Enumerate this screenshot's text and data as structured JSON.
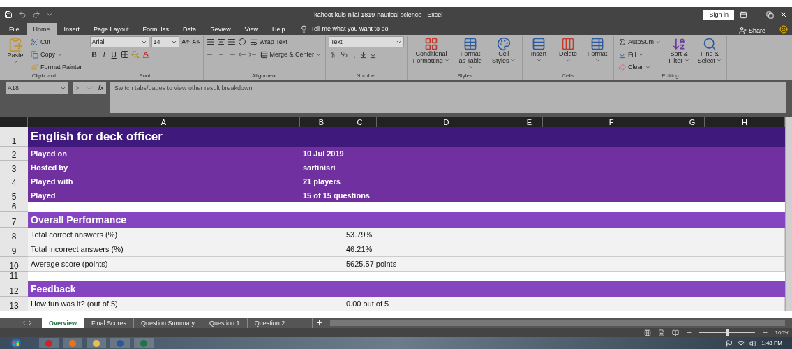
{
  "window": {
    "title": "kahoot kuis-nilai 1819-nautical science  -  Excel",
    "sign_in": "Sign in"
  },
  "menu": [
    {
      "label": "File",
      "selected": false
    },
    {
      "label": "Home",
      "selected": true
    },
    {
      "label": "Insert",
      "selected": false
    },
    {
      "label": "Page Layout",
      "selected": false
    },
    {
      "label": "Formulas",
      "selected": false
    },
    {
      "label": "Data",
      "selected": false
    },
    {
      "label": "Review",
      "selected": false
    },
    {
      "label": "View",
      "selected": false
    },
    {
      "label": "Help",
      "selected": false
    }
  ],
  "tell_me": "Tell me what you want to do",
  "share": "Share",
  "ribbon": {
    "clipboard": {
      "label": "Clipboard",
      "paste": "Paste",
      "cut": "Cut",
      "copy": "Copy",
      "format_painter": "Format Painter"
    },
    "font": {
      "label": "Font",
      "font_name": "Arial",
      "font_size": "14",
      "bold": "B",
      "italic": "I",
      "underline": "U"
    },
    "alignment": {
      "label": "Alignment",
      "wrap_text": "Wrap Text",
      "merge": "Merge & Center"
    },
    "number": {
      "label": "Number",
      "format": "Text",
      "currency": "$",
      "percent": "%",
      "comma": ","
    },
    "styles": {
      "label": "Styles",
      "buttons": [
        "Conditional Formatting",
        "Format as Table",
        "Cell Styles"
      ]
    },
    "cells": {
      "label": "Cells",
      "buttons": [
        "Insert",
        "Delete",
        "Format"
      ]
    },
    "editing": {
      "label": "Editing",
      "autosum": "AutoSum",
      "fill": "Fill",
      "clear": "Clear",
      "buttons": [
        "Sort & Filter",
        "Find & Select"
      ]
    }
  },
  "formula_bar": {
    "name_box": "A18",
    "fx": "fx",
    "content": "Switch tabs/pages to view other result breakdown"
  },
  "columns": [
    "A",
    "B",
    "C",
    "D",
    "E",
    "F",
    "G",
    "H"
  ],
  "rows": [
    {
      "num": "1",
      "kind": "title",
      "label": "English for deck officer"
    },
    {
      "num": "2",
      "kind": "header",
      "label": "Played on",
      "value": "10 Jul 2019"
    },
    {
      "num": "3",
      "kind": "header",
      "label": "Hosted by",
      "value": "sartinisri"
    },
    {
      "num": "4",
      "kind": "header",
      "label": "Played with",
      "value": "21 players"
    },
    {
      "num": "5",
      "kind": "header",
      "label": "Played",
      "value": "15 of 15 questions"
    },
    {
      "num": "6",
      "kind": "blank"
    },
    {
      "num": "7",
      "kind": "section",
      "label": "Overall Performance"
    },
    {
      "num": "8",
      "kind": "item",
      "label": "Total correct answers (%)",
      "value": "53.79%"
    },
    {
      "num": "9",
      "kind": "item",
      "label": "Total incorrect answers (%)",
      "value": "46.21%"
    },
    {
      "num": "10",
      "kind": "item",
      "label": "Average score (points)",
      "value": "5625.57 points"
    },
    {
      "num": "11",
      "kind": "blank"
    },
    {
      "num": "12",
      "kind": "section",
      "label": "Feedback"
    },
    {
      "num": "13",
      "kind": "item",
      "label": "How fun was it? (out of 5)",
      "value": "0.00 out of 5"
    }
  ],
  "sheet_tabs": [
    {
      "label": "Overview",
      "selected": true
    },
    {
      "label": "Final Scores",
      "selected": false
    },
    {
      "label": "Question Summary",
      "selected": false
    },
    {
      "label": "Question 1",
      "selected": false
    },
    {
      "label": "Question 2",
      "selected": false
    },
    {
      "label": "...",
      "selected": false
    }
  ],
  "status_bar": {
    "zoom": {
      "level": 0.5
    },
    "zoom_text": "100%"
  },
  "taskbar": {
    "time": "1:48 PM"
  }
}
